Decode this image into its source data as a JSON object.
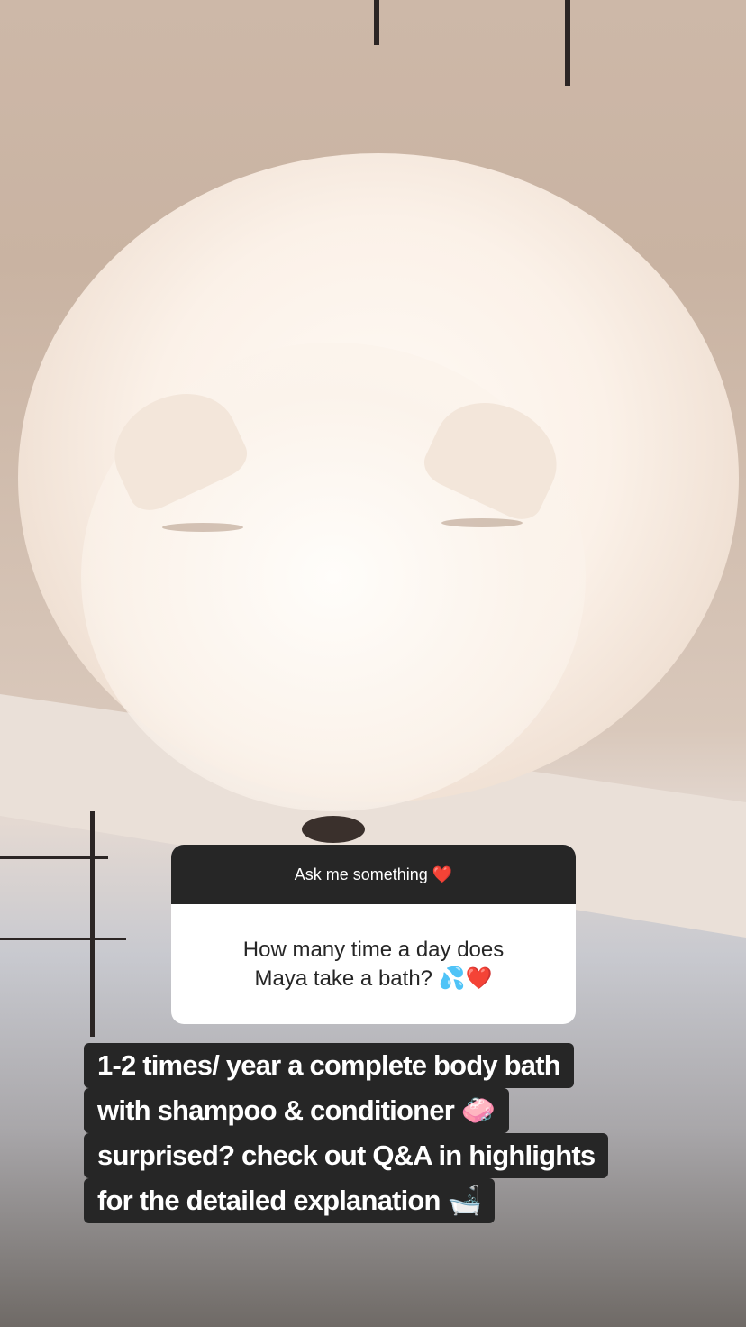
{
  "question_sticker": {
    "header": "Ask me something ❤️",
    "question": "How many time a day does Maya take a bath? 💦❤️"
  },
  "caption": {
    "lines": [
      "1-2 times/ year a complete body bath",
      "with shampoo & conditioner 🧼",
      "surprised? check out Q&A in highlights",
      "for the detailed explanation 🛁"
    ]
  }
}
